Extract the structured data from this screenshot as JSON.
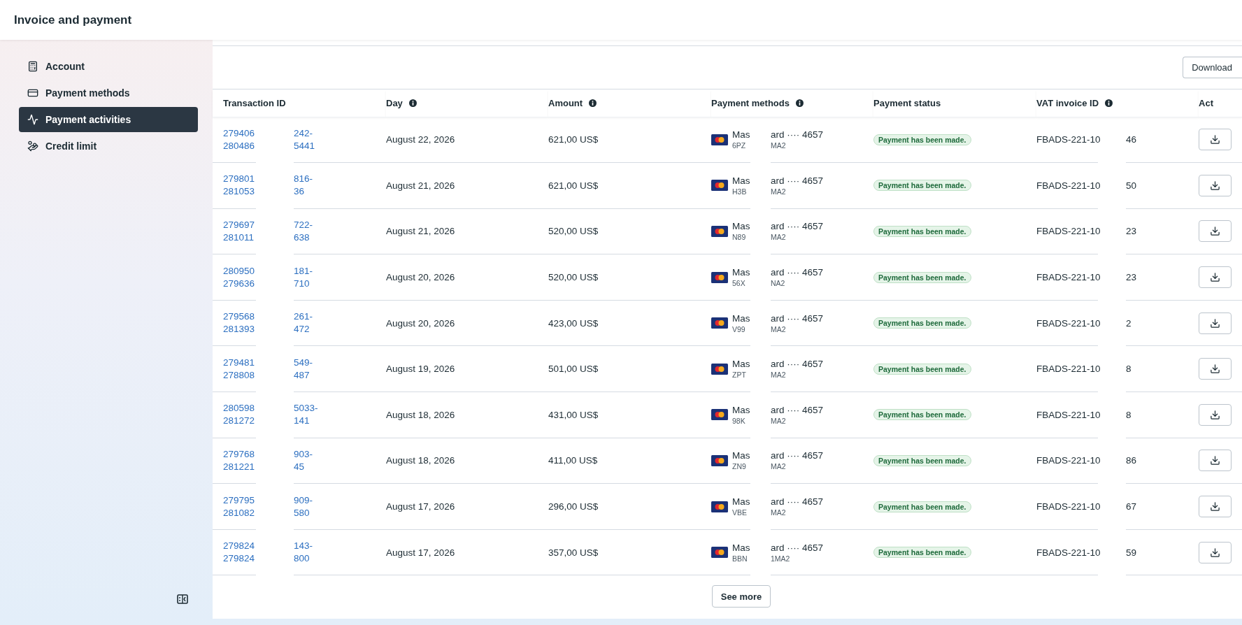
{
  "header": {
    "title": "Invoice and payment"
  },
  "sidebar": {
    "items": [
      {
        "label": "Account",
        "kind": "account",
        "selected": false
      },
      {
        "label": "Payment methods",
        "kind": "card",
        "selected": false
      },
      {
        "label": "Payment activities",
        "kind": "activity",
        "selected": true
      },
      {
        "label": "Credit limit",
        "kind": "credit",
        "selected": false
      }
    ]
  },
  "toolbar": {
    "download": "Download"
  },
  "table": {
    "columns": [
      {
        "label": "Transaction ID",
        "info": false
      },
      {
        "label": "Day",
        "info": true
      },
      {
        "label": "Amount",
        "info": true
      },
      {
        "label": "Payment methods",
        "info": true
      },
      {
        "label": "Payment status",
        "info": false
      },
      {
        "label": "VAT invoice ID",
        "info": true
      },
      {
        "label": "Act",
        "info": false
      }
    ],
    "rows": [
      {
        "transaction_id": {
          "start": [
            "279406",
            "280486"
          ],
          "end": [
            "242-",
            "5441"
          ]
        },
        "day": "August 22, 2026",
        "amount": "621,00 US$",
        "payment_method": {
          "start": "Mas",
          "end": "ard ···· 4657",
          "sub_start": "6PZ",
          "sub_end": "MA2"
        },
        "status": "Payment has been made.",
        "vat_invoice": {
          "start": "FBADS-221-10",
          "end": "46"
        }
      },
      {
        "transaction_id": {
          "start": [
            "279801",
            "281053"
          ],
          "end": [
            "816-",
            "36"
          ]
        },
        "day": "August 21, 2026",
        "amount": "621,00 US$",
        "payment_method": {
          "start": "Mas",
          "end": "ard ···· 4657",
          "sub_start": "H3B",
          "sub_end": "MA2"
        },
        "status": "Payment has been made.",
        "vat_invoice": {
          "start": "FBADS-221-10",
          "end": "50"
        }
      },
      {
        "transaction_id": {
          "start": [
            "279697",
            "281011"
          ],
          "end": [
            "722-",
            "638"
          ]
        },
        "day": "August 21, 2026",
        "amount": "520,00 US$",
        "payment_method": {
          "start": "Mas",
          "end": "ard ···· 4657",
          "sub_start": "N89",
          "sub_end": "MA2"
        },
        "status": "Payment has been made.",
        "vat_invoice": {
          "start": "FBADS-221-10",
          "end": "23"
        }
      },
      {
        "transaction_id": {
          "start": [
            "280950",
            "279636"
          ],
          "end": [
            "181-",
            "710"
          ]
        },
        "day": "August 20, 2026",
        "amount": "520,00 US$",
        "payment_method": {
          "start": "Mas",
          "end": "ard ···· 4657",
          "sub_start": "56X",
          "sub_end": "NA2"
        },
        "status": "Payment has been made.",
        "vat_invoice": {
          "start": "FBADS-221-10",
          "end": "23"
        }
      },
      {
        "transaction_id": {
          "start": [
            "279568",
            "281393"
          ],
          "end": [
            "261-",
            "472"
          ]
        },
        "day": "August 20, 2026",
        "amount": "423,00 US$",
        "payment_method": {
          "start": "Mas",
          "end": "ard ···· 4657",
          "sub_start": "V99",
          "sub_end": "MA2"
        },
        "status": "Payment has been made.",
        "vat_invoice": {
          "start": "FBADS-221-10",
          "end": "2"
        }
      },
      {
        "transaction_id": {
          "start": [
            "279481",
            "278808"
          ],
          "end": [
            "549-",
            "487"
          ]
        },
        "day": "August 19, 2026",
        "amount": "501,00 US$",
        "payment_method": {
          "start": "Mas",
          "end": "ard ···· 4657",
          "sub_start": "ZPT",
          "sub_end": "MA2"
        },
        "status": "Payment has been made.",
        "vat_invoice": {
          "start": "FBADS-221-10",
          "end": "8"
        }
      },
      {
        "transaction_id": {
          "start": [
            "280598",
            "281272"
          ],
          "end": [
            "5033-",
            "141"
          ]
        },
        "day": "August 18, 2026",
        "amount": "431,00 US$",
        "payment_method": {
          "start": "Mas",
          "end": "ard ···· 4657",
          "sub_start": "98K",
          "sub_end": "MA2"
        },
        "status": "Payment has been made.",
        "vat_invoice": {
          "start": "FBADS-221-10",
          "end": "8"
        }
      },
      {
        "transaction_id": {
          "start": [
            "279768",
            "281221"
          ],
          "end": [
            "903-",
            "45"
          ]
        },
        "day": "August 18, 2026",
        "amount": "411,00 US$",
        "payment_method": {
          "start": "Mas",
          "end": "ard ···· 4657",
          "sub_start": "ZN9",
          "sub_end": "MA2"
        },
        "status": "Payment has been made.",
        "vat_invoice": {
          "start": "FBADS-221-10",
          "end": "86"
        }
      },
      {
        "transaction_id": {
          "start": [
            "279795",
            "281082"
          ],
          "end": [
            "909-",
            "580"
          ]
        },
        "day": "August 17, 2026",
        "amount": "296,00 US$",
        "payment_method": {
          "start": "Mas",
          "end": "ard ···· 4657",
          "sub_start": "VBE",
          "sub_end": "MA2"
        },
        "status": "Payment has been made.",
        "vat_invoice": {
          "start": "FBADS-221-10",
          "end": "67"
        }
      },
      {
        "transaction_id": {
          "start": [
            "279824",
            "279824"
          ],
          "end": [
            "143-",
            "800"
          ]
        },
        "day": "August 17, 2026",
        "amount": "357,00 US$",
        "payment_method": {
          "start": "Mas",
          "end": "ard ···· 4657",
          "sub_start": "BBN",
          "sub_end": "1MA2"
        },
        "status": "Payment has been made.",
        "vat_invoice": {
          "start": "FBADS-221-10",
          "end": "59"
        }
      }
    ]
  },
  "see_more": "See more"
}
